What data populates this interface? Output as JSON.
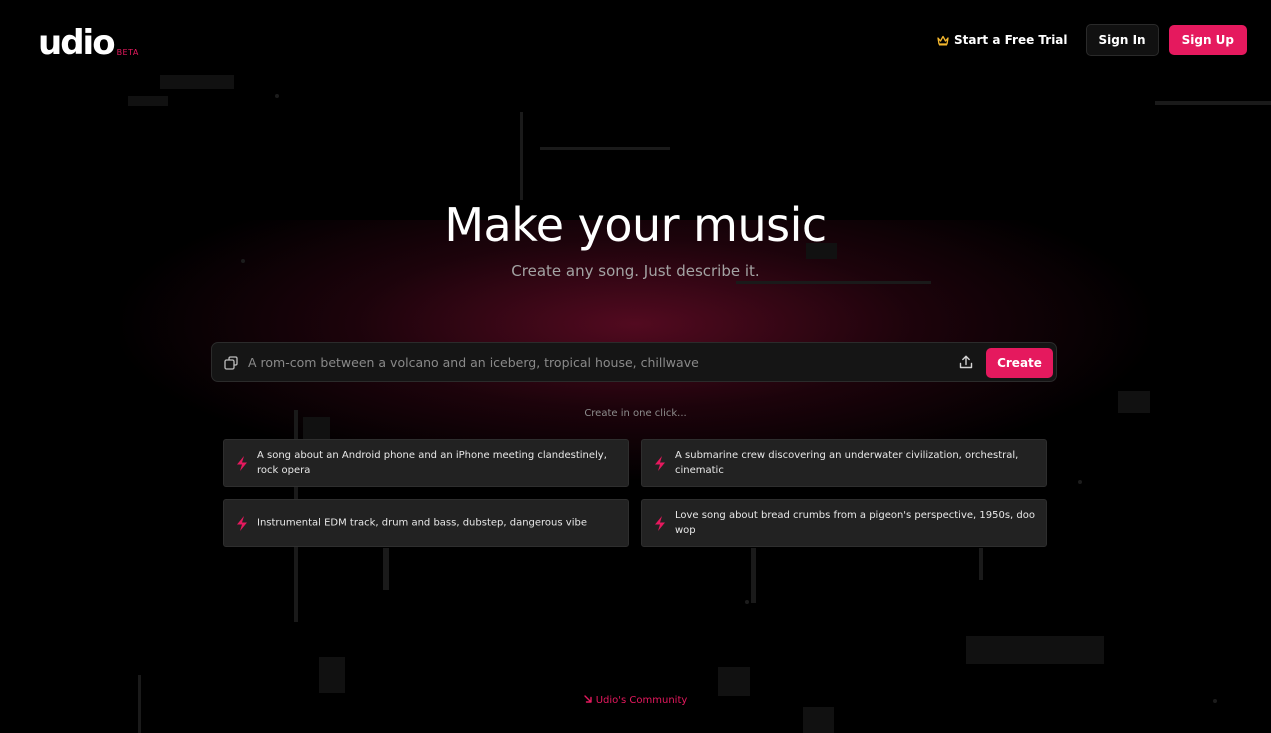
{
  "brand": {
    "logo_text": "udio",
    "beta_badge": "BETA",
    "accent_color": "#e5195e"
  },
  "header": {
    "trial_label": "Start a Free Trial",
    "trial_icon": "crown-icon",
    "signin_label": "Sign In",
    "signup_label": "Sign Up"
  },
  "hero": {
    "title": "Make your music",
    "subtitle": "Create any song. Just describe it."
  },
  "prompt": {
    "placeholder": "A rom-com between a volcano and an iceberg, tropical house, chillwave",
    "value": "",
    "left_icon": "shuffle-icon",
    "upload_icon": "upload-icon",
    "create_label": "Create"
  },
  "suggestions": {
    "label": "Create in one click...",
    "icon": "bolt-icon",
    "items": [
      {
        "text": "A song about an Android phone and an iPhone meeting clandestinely, rock opera"
      },
      {
        "text": "A submarine crew discovering an underwater civilization, orchestral, cinematic"
      },
      {
        "text": "Instrumental EDM track, drum and bass, dubstep, dangerous vibe"
      },
      {
        "text": "Love song about bread crumbs from a pigeon's perspective, 1950s, doo wop"
      }
    ]
  },
  "footer": {
    "community_label": "Udio's Community",
    "community_icon": "arrow-down-right-icon"
  }
}
